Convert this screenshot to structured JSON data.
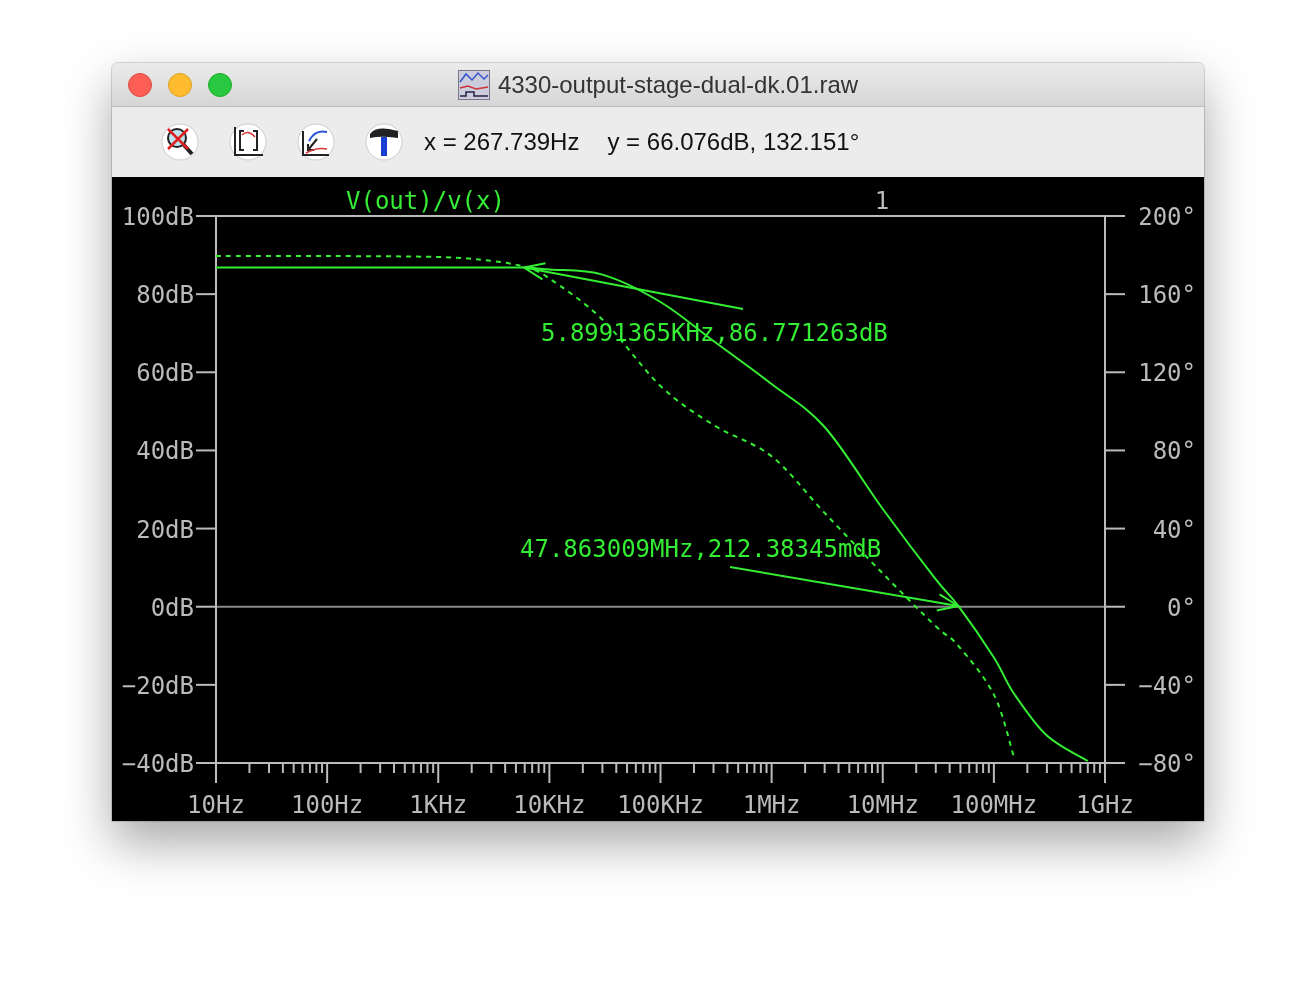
{
  "window": {
    "title": "4330-output-stage-dual-dk.01.raw"
  },
  "toolbar": {
    "readouts": [
      "x = 267.739Hz",
      "y = 66.076dB, 132.151°"
    ]
  },
  "plot": {
    "trace_label": "V(out)/v(x)",
    "cursor_label": "1",
    "left_axis_labels": [
      "100dB",
      "80dB",
      "60dB",
      "40dB",
      "20dB",
      "0dB",
      "−20dB",
      "−40dB"
    ],
    "right_axis_labels": [
      "200°",
      "160°",
      "120°",
      "80°",
      "40°",
      "0°",
      "−40°",
      "−80°"
    ],
    "bottom_axis_labels": [
      "10Hz",
      "100Hz",
      "1KHz",
      "10KHz",
      "100KHz",
      "1MHz",
      "10MHz",
      "100MHz",
      "1GHz"
    ],
    "annotations": [
      "5.8991365KHz,86.771263dB",
      "47.863009MHz,212.38345mdB"
    ]
  }
}
